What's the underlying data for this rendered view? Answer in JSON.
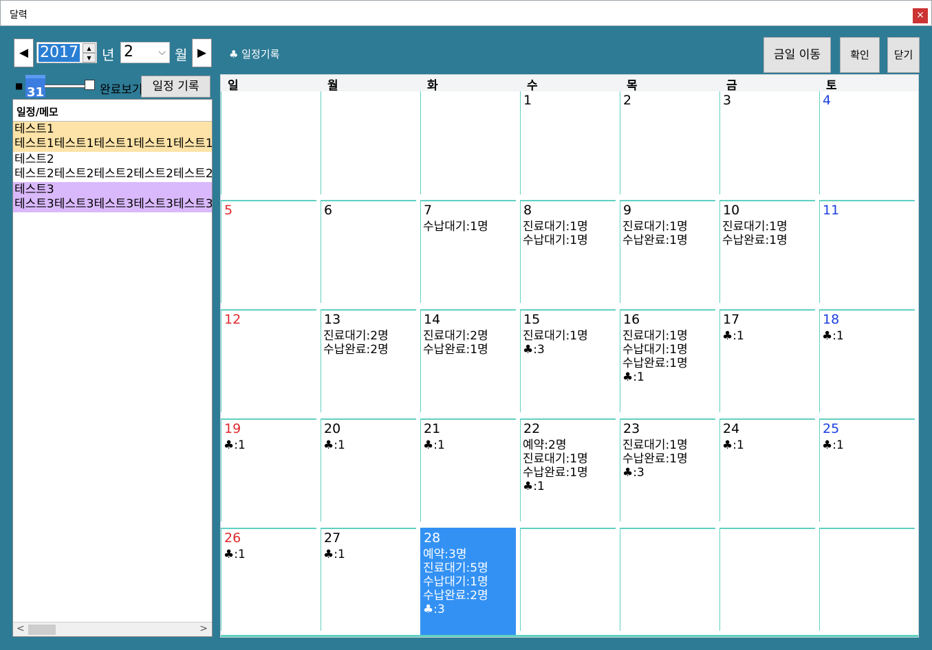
{
  "window": {
    "title": "달력",
    "close_label": "×"
  },
  "nav": {
    "prev": "◀",
    "next": "▶",
    "year": "2017",
    "year_unit": "년",
    "month": "2",
    "month_unit": "월",
    "spin_up": "▲",
    "spin_down": "▼",
    "dropdown": "⌵"
  },
  "plan_link": "♣ 일정기록",
  "buttons": {
    "today": "금일 이동",
    "ok": "확인",
    "close": "닫기"
  },
  "toolbar": {
    "square": "■",
    "cal_icon_day": "31",
    "done_view": "완료보기",
    "record": "일정 기록"
  },
  "memo": {
    "header": "일정/메모",
    "items": [
      {
        "title": "테스트1",
        "body": "테스트1테스트1테스트1테스트1테스트1",
        "color": "#fde3a7"
      },
      {
        "title": "테스트2",
        "body": "테스트2테스트2테스트2테스트2테스트2",
        "color": "#ffffff"
      },
      {
        "title": "테스트3",
        "body": "테스트3테스트3테스트3테스트3테스트3",
        "color": "#d9b8fb"
      }
    ],
    "scroll_left": "<",
    "scroll_right": ">"
  },
  "calendar": {
    "weekdays": [
      "일",
      "월",
      "화",
      "수",
      "목",
      "금",
      "토"
    ],
    "colors": {
      "grid": "#5fd0c0",
      "sunday": "#e0282d",
      "saturday": "#1b3ee0",
      "today": "#3391f3"
    },
    "weeks": [
      [
        {
          "day": "",
          "lines": []
        },
        {
          "day": "",
          "lines": []
        },
        {
          "day": "",
          "lines": []
        },
        {
          "day": "1",
          "lines": []
        },
        {
          "day": "2",
          "lines": []
        },
        {
          "day": "3",
          "lines": []
        },
        {
          "day": "4",
          "lines": []
        }
      ],
      [
        {
          "day": "5",
          "lines": []
        },
        {
          "day": "6",
          "lines": []
        },
        {
          "day": "7",
          "lines": [
            "수납대기:1명"
          ]
        },
        {
          "day": "8",
          "lines": [
            "진료대기:1명",
            "수납대기:1명"
          ]
        },
        {
          "day": "9",
          "lines": [
            "진료대기:1명",
            "수납완료:1명"
          ]
        },
        {
          "day": "10",
          "lines": [
            "진료대기:1명",
            "수납완료:1명"
          ]
        },
        {
          "day": "11",
          "lines": []
        }
      ],
      [
        {
          "day": "12",
          "lines": []
        },
        {
          "day": "13",
          "lines": [
            "진료대기:2명",
            "수납완료:2명"
          ]
        },
        {
          "day": "14",
          "lines": [
            "진료대기:2명",
            "수납완료:1명"
          ]
        },
        {
          "day": "15",
          "lines": [
            "진료대기:1명",
            "♣:3"
          ]
        },
        {
          "day": "16",
          "lines": [
            "진료대기:1명",
            "수납대기:1명",
            "수납완료:1명",
            "♣:1"
          ]
        },
        {
          "day": "17",
          "lines": [
            "♣:1"
          ]
        },
        {
          "day": "18",
          "lines": [
            "♣:1"
          ]
        }
      ],
      [
        {
          "day": "19",
          "lines": [
            "♣:1"
          ]
        },
        {
          "day": "20",
          "lines": [
            "♣:1"
          ]
        },
        {
          "day": "21",
          "lines": [
            "♣:1"
          ]
        },
        {
          "day": "22",
          "lines": [
            "예약:2명",
            "진료대기:1명",
            "수납완료:1명",
            "♣:1"
          ]
        },
        {
          "day": "23",
          "lines": [
            "진료대기:1명",
            "수납완료:1명",
            "♣:3"
          ]
        },
        {
          "day": "24",
          "lines": [
            "♣:1"
          ]
        },
        {
          "day": "25",
          "lines": [
            "♣:1"
          ]
        }
      ],
      [
        {
          "day": "26",
          "lines": [
            "♣:1"
          ]
        },
        {
          "day": "27",
          "lines": [
            "♣:1"
          ]
        },
        {
          "day": "28",
          "lines": [
            "예약:3명",
            "진료대기:5명",
            "수납대기:1명",
            "수납완료:2명",
            "♣:3"
          ],
          "today": true
        },
        {
          "day": "",
          "lines": []
        },
        {
          "day": "",
          "lines": []
        },
        {
          "day": "",
          "lines": []
        },
        {
          "day": "",
          "lines": []
        }
      ]
    ]
  }
}
